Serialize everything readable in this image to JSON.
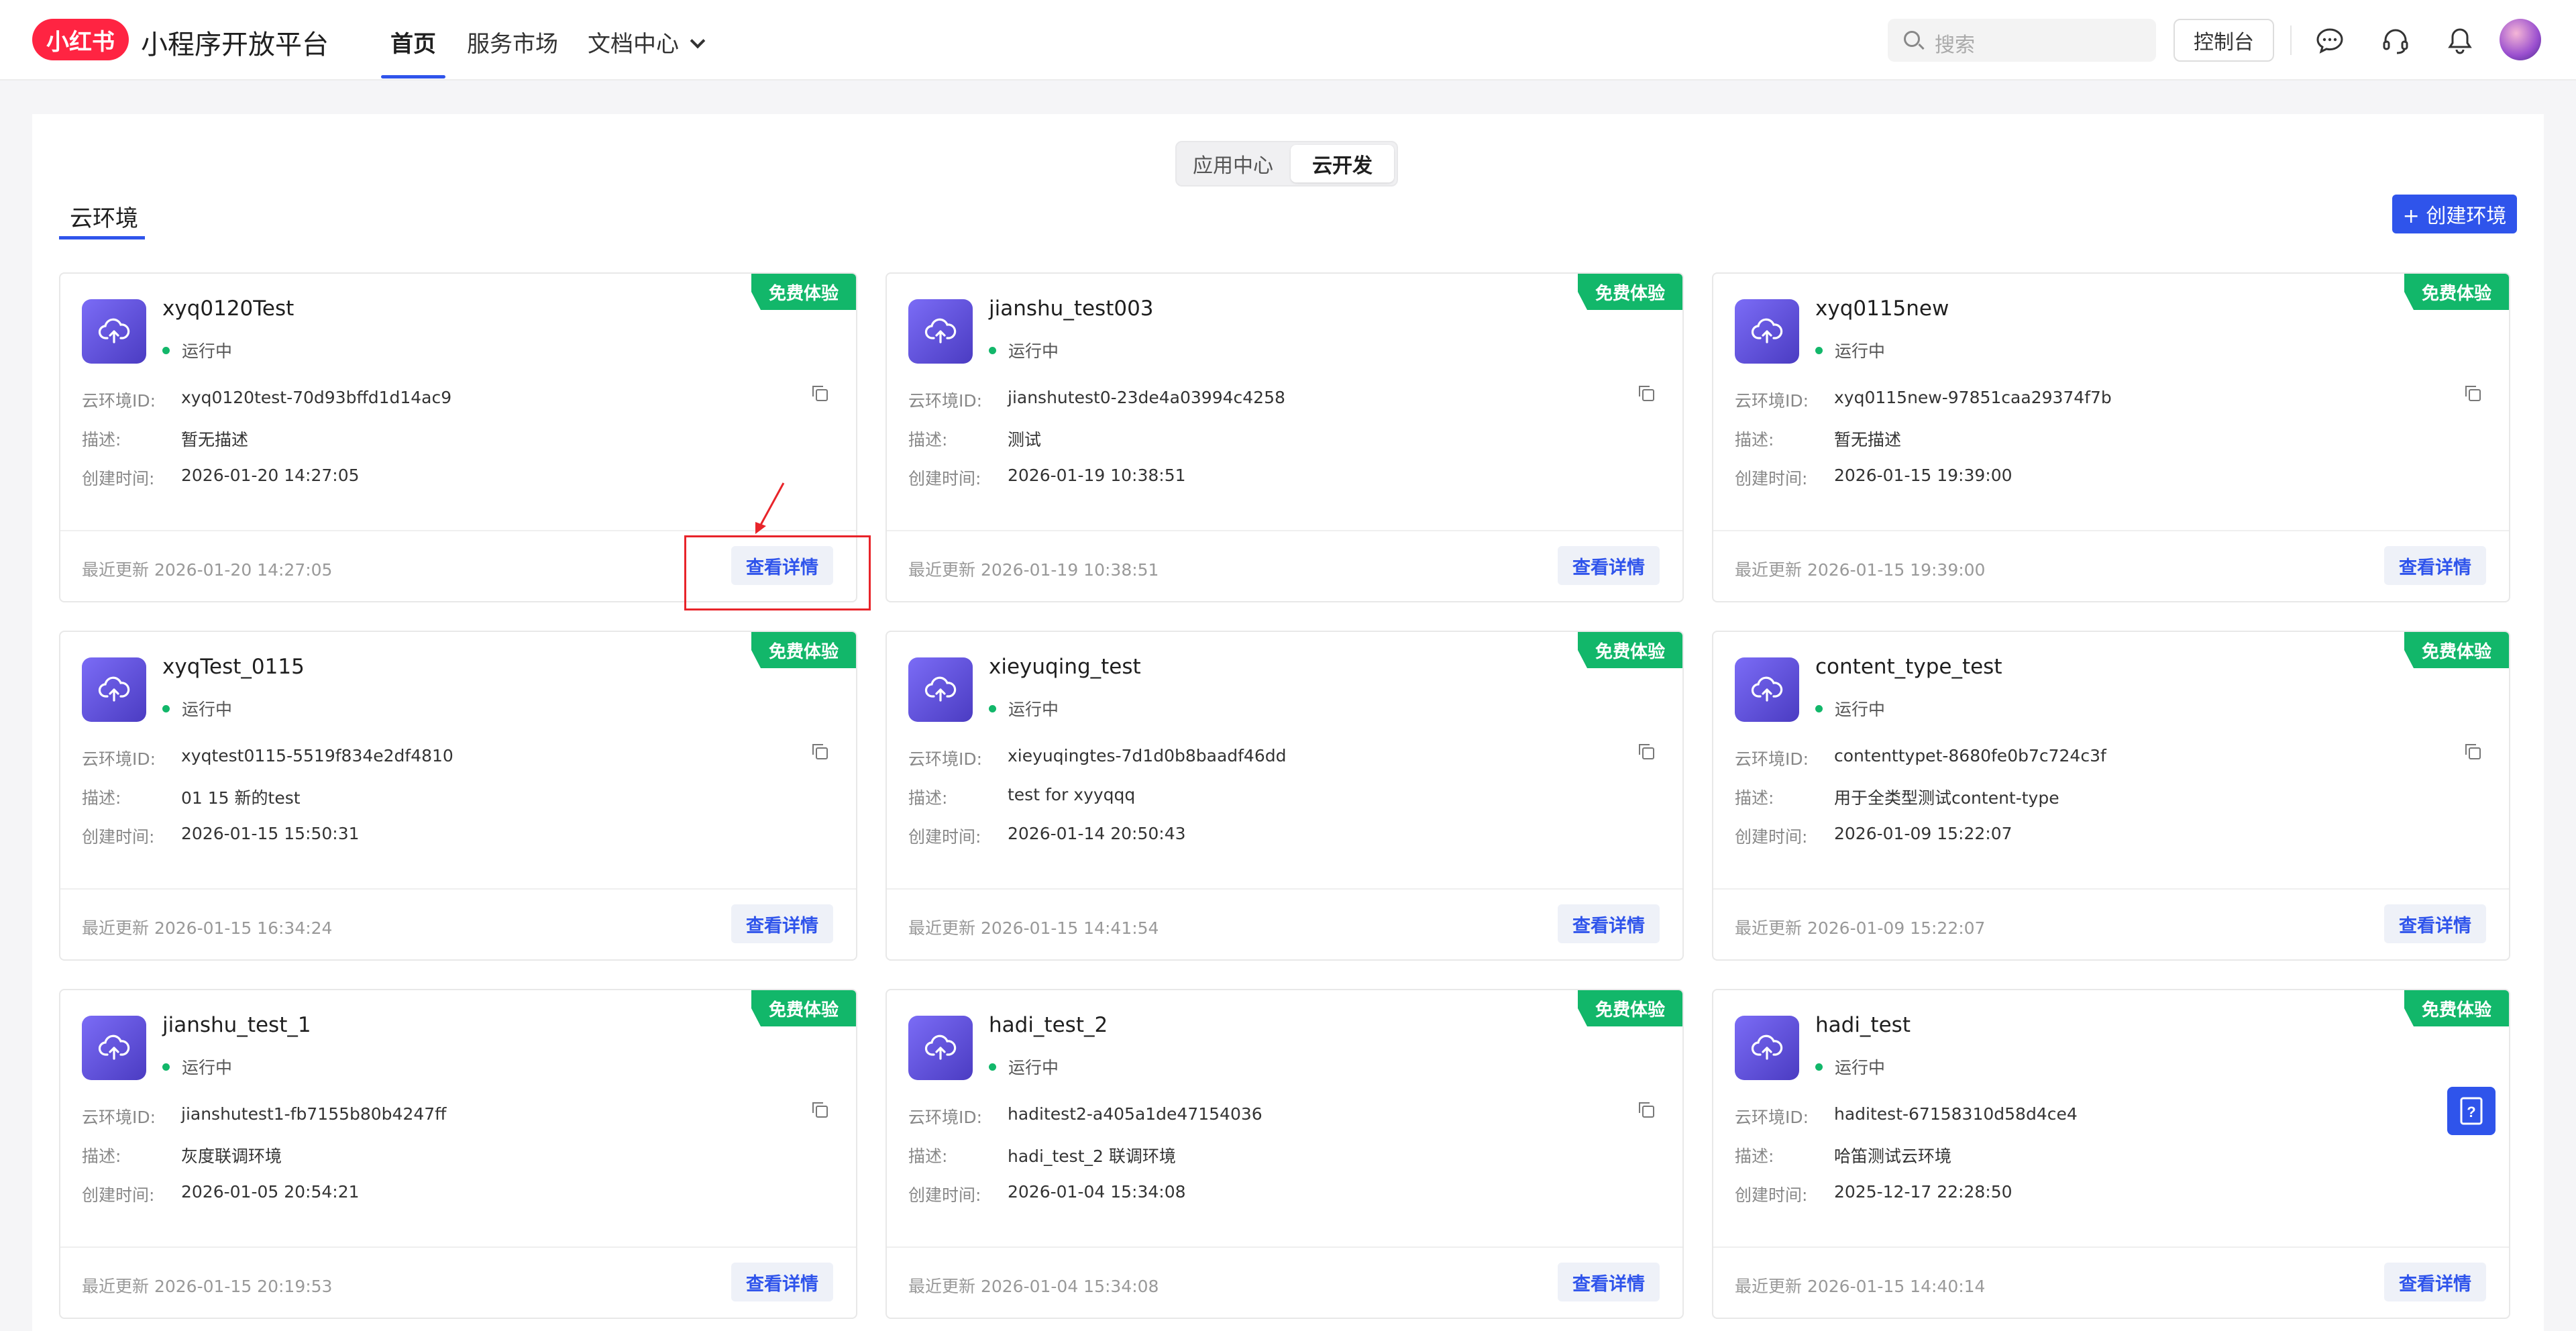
{
  "header": {
    "logo_text": "小红书",
    "platform_name": "小程序开放平台",
    "nav": [
      {
        "label": "首页",
        "active": true
      },
      {
        "label": "服务市场",
        "active": false
      },
      {
        "label": "文档中心",
        "active": false
      }
    ],
    "search_placeholder": "搜索",
    "console_label": "控制台"
  },
  "segment": {
    "options": [
      "应用中心",
      "云开发"
    ],
    "selected": "云开发"
  },
  "section": {
    "tab_label": "云环境",
    "create_label": "+ 创建环境"
  },
  "labels": {
    "env_id": "云环境ID:",
    "desc": "描述:",
    "created": "创建时间:",
    "updated_prefix": "最近更新",
    "detail_button": "查看详情",
    "badge": "免费体验",
    "status": "运行中"
  },
  "environments": [
    {
      "name": "xyq0120Test",
      "env_id": "xyq0120test-70d93bffd1d14ac9",
      "desc": "暂无描述",
      "created": "2026-01-20 14:27:05",
      "updated": "最近更新 2026-01-20 14:27:05"
    },
    {
      "name": "jianshu_test003",
      "env_id": "jianshutest0-23de4a03994c4258",
      "desc": "测试",
      "created": "2026-01-19 10:38:51",
      "updated": "最近更新 2026-01-19 10:38:51"
    },
    {
      "name": "xyq0115new",
      "env_id": "xyq0115new-97851caa29374f7b",
      "desc": "暂无描述",
      "created": "2026-01-15 19:39:00",
      "updated": "最近更新 2026-01-15 19:39:00"
    },
    {
      "name": "xyqTest_0115",
      "env_id": "xyqtest0115-5519f834e2df4810",
      "desc": "01 15 新的test",
      "created": "2026-01-15 15:50:31",
      "updated": "最近更新 2026-01-15 16:34:24"
    },
    {
      "name": "xieyuqing_test",
      "env_id": "xieyuqingtes-7d1d0b8baadf46dd",
      "desc": "test for xyyqqq",
      "created": "2026-01-14 20:50:43",
      "updated": "最近更新 2026-01-15 14:41:54"
    },
    {
      "name": "content_type_test",
      "env_id": "contenttypet-8680fe0b7c724c3f",
      "desc": "用于全类型测试content-type",
      "created": "2026-01-09 15:22:07",
      "updated": "最近更新 2026-01-09 15:22:07"
    },
    {
      "name": "jianshu_test_1",
      "env_id": "jianshutest1-fb7155b80b4247ff",
      "desc": "灰度联调环境",
      "created": "2026-01-05 20:54:21",
      "updated": "最近更新 2026-01-15 20:19:53"
    },
    {
      "name": "hadi_test_2",
      "env_id": "haditest2-a405a1de47154036",
      "desc": "hadi_test_2 联调环境",
      "created": "2026-01-04 15:34:08",
      "updated": "最近更新 2026-01-04 15:34:08"
    },
    {
      "name": "hadi_test",
      "env_id": "haditest-67158310d58d4ce4",
      "desc": "哈笛测试云环境",
      "created": "2025-12-17 22:28:50",
      "updated": "最近更新 2026-01-15 14:40:14"
    }
  ],
  "colors": {
    "accent": "#2f54eb",
    "badge": "#12b76a",
    "brand": "#ff2442",
    "highlight": "#e8242a"
  }
}
